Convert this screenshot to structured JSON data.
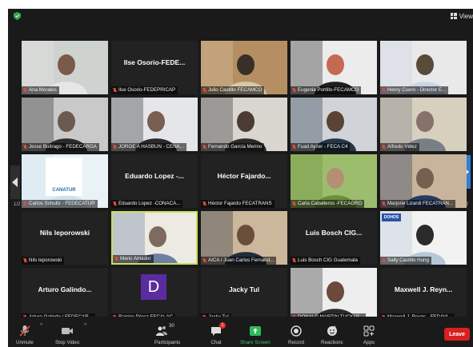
{
  "toolbar": {
    "view_label": "View",
    "buttons": [
      {
        "label": "Unmute"
      },
      {
        "label": "Stop Video"
      },
      {
        "label": "Participants",
        "count": "30"
      },
      {
        "label": "Chat",
        "badge": "1"
      },
      {
        "label": "Share Screen"
      },
      {
        "label": "Record"
      },
      {
        "label": "Reactions"
      },
      {
        "label": "Apps"
      }
    ],
    "leave_label": "Leave"
  },
  "page_indicators": {
    "left": "1/2",
    "right": "1/2"
  },
  "participants": [
    {
      "name": "Ana Morales",
      "big": "",
      "video": "v1"
    },
    {
      "name": "Ilse Osorio-FEDEPRICAP",
      "big": "Ilse Osorio-FEDE...",
      "video": ""
    },
    {
      "name": "Julio Castillo FECAMCO",
      "big": "",
      "video": "v2"
    },
    {
      "name": "Eugenia Portillo-FECAMCO",
      "big": "",
      "video": "v3"
    },
    {
      "name": "Henry Cuero - Director E...",
      "big": "",
      "video": "v4"
    },
    {
      "name": "Jesse Buitrago - FEDECARGA",
      "big": "",
      "video": "v5"
    },
    {
      "name": "JORGE A HASBUN - CENA...",
      "big": "",
      "video": "v6"
    },
    {
      "name": "Fernando García Merino",
      "big": "",
      "video": "v7"
    },
    {
      "name": "Fuad Ayzer - FECA C4",
      "big": "",
      "video": "v8"
    },
    {
      "name": "Alfredo Vélez",
      "big": "",
      "video": "v9"
    },
    {
      "name": "Carlos Schultz - FEDECATUR",
      "big": "",
      "video": "v10",
      "logo": "CANATUR"
    },
    {
      "name": "Eduardo Lopez -CONACA...",
      "big": "Eduardo Lopez -...",
      "video": ""
    },
    {
      "name": "Héctor Fajardo FECATRANS",
      "big": "Héctor Fajardo...",
      "video": ""
    },
    {
      "name": "Carla Caballeros -FECAGRO",
      "big": "",
      "video": "v11"
    },
    {
      "name": "Marjorie Lizardi FECATRAN...",
      "big": "",
      "video": "v12"
    },
    {
      "name": "Nils leporowski",
      "big": "Nils leporowski",
      "video": ""
    },
    {
      "name": "Mario Amador",
      "big": "",
      "video": "v13",
      "active": true
    },
    {
      "name": "AICA / Juan Carlos Fernand...",
      "big": "",
      "video": "v14"
    },
    {
      "name": "Luis Bosch CIG Guatemala",
      "big": "Luis Bosch CIG...",
      "video": ""
    },
    {
      "name": "Sally Castillo Hung",
      "big": "",
      "video": "v15",
      "logo": "DOHOS"
    },
    {
      "name": "Arturo Galindo / FEDECAR...",
      "big": "Arturo Galindo...",
      "video": ""
    },
    {
      "name": "Ramiro Pérez FECALAC",
      "big": "",
      "video": "",
      "avatar": "D"
    },
    {
      "name": "Jacky Tul",
      "big": "Jacky Tul",
      "video": ""
    },
    {
      "name": "DONALD MARTIN TUCKLE...",
      "big": "",
      "video": "v16"
    },
    {
      "name": "Maxwell J. Reyns - FEDAVI...",
      "big": "Maxwell J. Reyn...",
      "video": ""
    }
  ]
}
